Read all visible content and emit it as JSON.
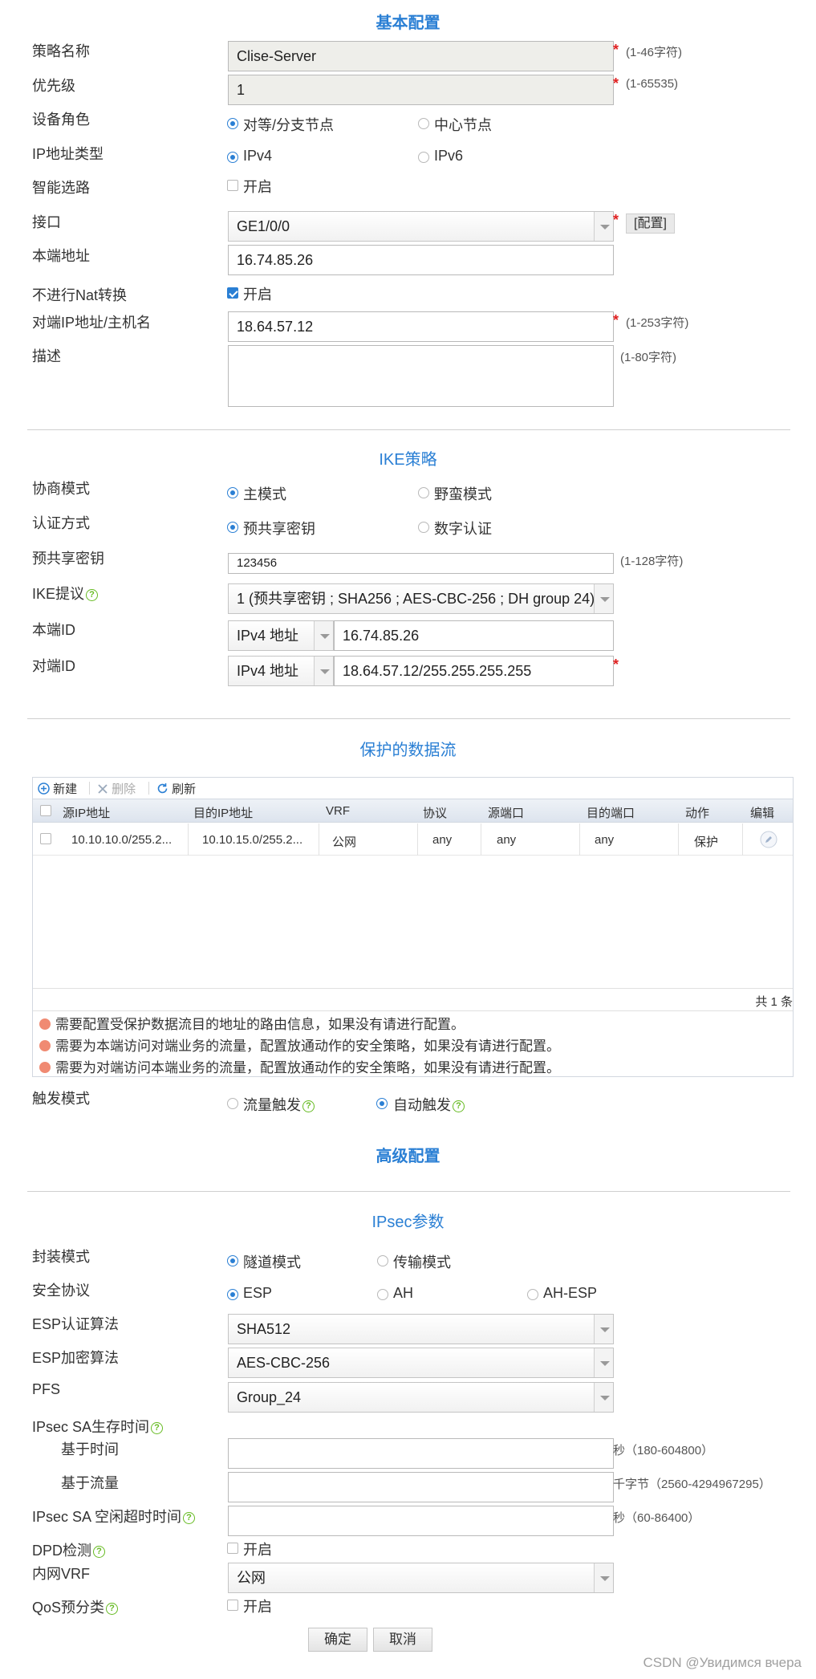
{
  "basic": {
    "title": "基本配置",
    "policy_name_label": "策略名称",
    "policy_name_value": "Clise-Server",
    "policy_name_hint": "(1-46字符)",
    "priority_label": "优先级",
    "priority_value": "1",
    "priority_hint": "(1-65535)",
    "role_label": "设备角色",
    "role_opt1": "对等/分支节点",
    "role_opt2": "中心节点",
    "ip_type_label": "IP地址类型",
    "ip_type_opt1": "IPv4",
    "ip_type_opt2": "IPv6",
    "smart_route_label": "智能选路",
    "smart_route_opt": "开启",
    "interface_label": "接口",
    "interface_value": "GE1/0/0",
    "interface_config_button": "[配置]",
    "local_addr_label": "本端地址",
    "local_addr_value": "16.74.85.26",
    "no_nat_label": "不进行Nat转换",
    "no_nat_opt": "开启",
    "peer_label": "对端IP地址/主机名",
    "peer_value": "18.64.57.12",
    "peer_hint": "(1-253字符)",
    "desc_label": "描述",
    "desc_value": "",
    "desc_hint": "(1-80字符)",
    "required_mark": "*"
  },
  "ike": {
    "title": "IKE策略",
    "mode_label": "协商模式",
    "mode_opt1": "主模式",
    "mode_opt2": "野蛮模式",
    "auth_label": "认证方式",
    "auth_opt1": "预共享密钥",
    "auth_opt2": "数字认证",
    "psk_label": "预共享密钥",
    "psk_value": "123456",
    "psk_hint": "(1-128字符)",
    "proposal_label": "IKE提议",
    "proposal_value": "1 (预共享密钥 ; SHA256 ; AES-CBC-256 ; DH group 24)",
    "local_id_label": "本端ID",
    "local_id_type": "IPv4 地址",
    "local_id_value": "16.74.85.26",
    "peer_id_label": "对端ID",
    "peer_id_type": "IPv4 地址",
    "peer_id_value": "18.64.57.12/255.255.255.255"
  },
  "flow": {
    "title": "保护的数据流",
    "toolbar": {
      "new": "新建",
      "delete": "删除",
      "refresh": "刷新"
    },
    "columns": [
      "源IP地址",
      "目的IP地址",
      "VRF",
      "协议",
      "源端口",
      "目的端口",
      "动作",
      "编辑"
    ],
    "rows": [
      {
        "src": "10.10.10.0/255.2...",
        "dst": "10.10.15.0/255.2...",
        "vrf": "公网",
        "proto": "any",
        "sport": "any",
        "dport": "any",
        "action": "保护"
      }
    ],
    "total": "共 1 条",
    "notes": [
      "需要配置受保护数据流目的地址的路由信息，如果没有请进行配置。",
      "需要为本端访问对端业务的流量，配置放通动作的安全策略，如果没有请进行配置。",
      "需要为对端访问本端业务的流量，配置放通动作的安全策略，如果没有请进行配置。"
    ],
    "trigger_label": "触发模式",
    "trigger_opt1": "流量触发",
    "trigger_opt2": "自动触发"
  },
  "advanced": {
    "title": "高级配置"
  },
  "ipsec": {
    "title": "IPsec参数",
    "encap_label": "封装模式",
    "encap_opt1": "隧道模式",
    "encap_opt2": "传输模式",
    "proto_label": "安全协议",
    "proto_opt1": "ESP",
    "proto_opt2": "AH",
    "proto_opt3": "AH-ESP",
    "esp_auth_label": "ESP认证算法",
    "esp_auth_value": "SHA512",
    "esp_enc_label": "ESP加密算法",
    "esp_enc_value": "AES-CBC-256",
    "pfs_label": "PFS",
    "pfs_value": "Group_24",
    "sa_life_label": "IPsec SA生存时间",
    "time_label": "基于时间",
    "time_value": "",
    "time_hint": "秒（180-604800）",
    "traffic_label": "基于流量",
    "traffic_value": "",
    "traffic_hint": "千字节（2560-4294967295）",
    "idle_label": "IPsec SA 空闲超时时间",
    "idle_value": "",
    "idle_hint": "秒（60-86400）",
    "dpd_label": "DPD检测",
    "dpd_opt": "开启",
    "vrf_label": "内网VRF",
    "vrf_value": "公网",
    "qos_label": "QoS预分类",
    "qos_opt": "开启"
  },
  "actions": {
    "ok": "确定",
    "cancel": "取消"
  },
  "watermark": "CSDN @Увидимся вчера"
}
